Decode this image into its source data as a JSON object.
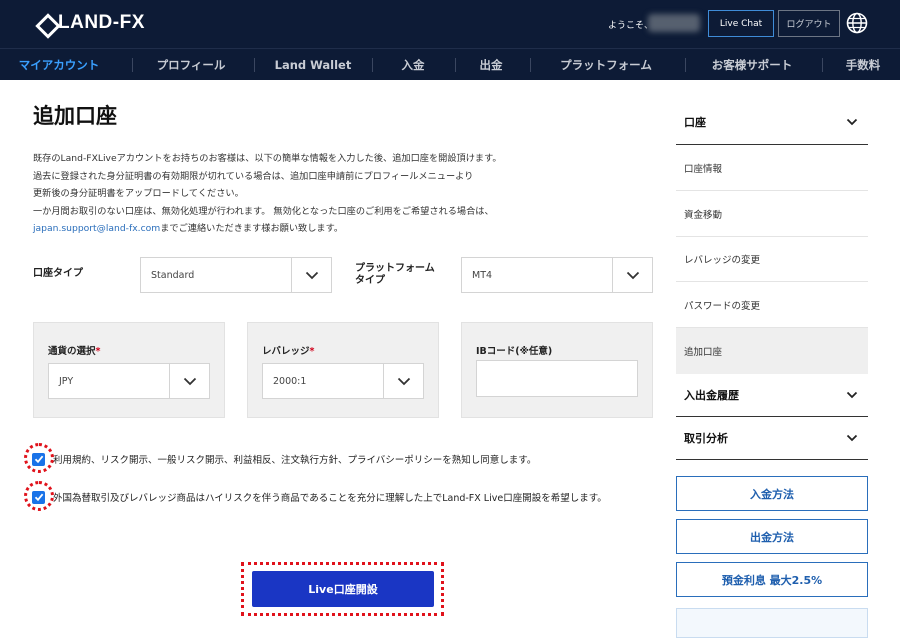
{
  "header": {
    "logo_text": "LAND-FX",
    "welcome_text": "ようこそ、",
    "live_chat_label": "Live Chat",
    "logout_label": "ログアウト"
  },
  "nav": {
    "items": [
      {
        "label": "マイアカウント",
        "active": true
      },
      {
        "label": "プロフィール"
      },
      {
        "label": "Land Wallet"
      },
      {
        "label": "入金"
      },
      {
        "label": "出金"
      },
      {
        "label": "プラットフォーム"
      },
      {
        "label": "お客様サポート"
      },
      {
        "label": "手数料"
      }
    ]
  },
  "main": {
    "title": "追加口座",
    "intro": {
      "line1": "既存のLand-FXLiveアカウントをお持ちのお客様は、以下の簡単な情報を入力した後、追加口座を開設頂けます。",
      "line2": "過去に登録された身分証明書の有効期限が切れている場合は、追加口座申請前にプロフィールメニューより",
      "line3": "更新後の身分証明書をアップロードしてください。",
      "line4": "一か月間お取引のない口座は、無効化処理が行われます。 無効化となった口座のご利用をご希望される場合は、",
      "email": "japan.support@land-fx.com",
      "line5_suffix": "までご連絡いただきます様お願い致します。"
    },
    "account_type": {
      "label": "口座タイプ",
      "value": "Standard"
    },
    "platform_type": {
      "label": "プラットフォーム タイプ",
      "value": "MT4"
    },
    "currency": {
      "label": "通貨の選択",
      "required_mark": "*",
      "value": "JPY"
    },
    "leverage": {
      "label": "レバレッジ",
      "required_mark": "*",
      "value": "2000:1"
    },
    "ib_code": {
      "label": "IBコード(※任意)",
      "value": ""
    },
    "agree_terms": "利用規約、リスク開示、一般リスク開示、利益相反、注文執行方針、プライバシーポリシーを熟知し同意します。",
    "agree_risk": "外国為替取引及びレバレッジ商品はハイリスクを伴う商品であることを充分に理解した上でLand-FX Live口座開設を希望します。",
    "submit_label": "Live口座開設"
  },
  "sidebar": {
    "account_header": "口座",
    "account_items": [
      "口座情報",
      "資金移動",
      "レバレッジの変更",
      "パスワードの変更",
      "追加口座"
    ],
    "history_header": "入出金履歴",
    "analysis_header": "取引分析",
    "deposit_btn": "入金方法",
    "withdraw_btn": "出金方法",
    "interest_btn": "預金利息 最大2.5%"
  },
  "colors": {
    "header_bg": "#0d1b36",
    "nav_active": "#3aa0ff",
    "submit_bg": "#1a36c4",
    "highlight": "#e0121b",
    "checkbox": "#1a73e8"
  }
}
